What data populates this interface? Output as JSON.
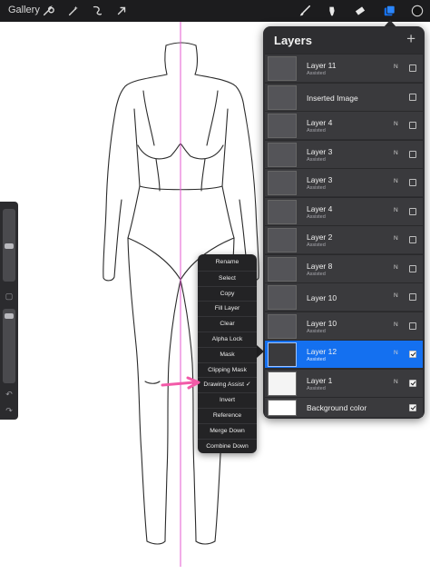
{
  "topbar": {
    "gallery_label": "Gallery",
    "left_tools": [
      "wrench-icon",
      "magic-wand-icon",
      "selection-icon",
      "transform-arrow-icon"
    ],
    "right_tools": [
      "brush-icon",
      "smudge-icon",
      "eraser-icon",
      "layers-icon",
      "color-icon"
    ]
  },
  "layers_panel": {
    "title": "Layers",
    "add_label": "+",
    "layers": [
      {
        "name": "Layer 11",
        "sub": "Assisted",
        "mode": "N",
        "visible": false,
        "selected": false
      },
      {
        "name": "Inserted Image",
        "sub": "",
        "mode": "",
        "visible": false,
        "selected": false
      },
      {
        "name": "Layer 4",
        "sub": "Assisted",
        "mode": "N",
        "visible": false,
        "selected": false
      },
      {
        "name": "Layer 3",
        "sub": "Assisted",
        "mode": "N",
        "visible": false,
        "selected": false
      },
      {
        "name": "Layer 3",
        "sub": "Assisted",
        "mode": "N",
        "visible": false,
        "selected": false
      },
      {
        "name": "Layer 4",
        "sub": "Assisted",
        "mode": "N",
        "visible": false,
        "selected": false
      },
      {
        "name": "Layer 2",
        "sub": "Assisted",
        "mode": "N",
        "visible": false,
        "selected": false
      },
      {
        "name": "Layer 8",
        "sub": "Assisted",
        "mode": "N",
        "visible": false,
        "selected": false
      },
      {
        "name": "Layer 10",
        "sub": "",
        "mode": "N",
        "visible": false,
        "selected": false
      },
      {
        "name": "Layer 10",
        "sub": "Assisted",
        "mode": "N",
        "visible": false,
        "selected": false
      },
      {
        "name": "Layer 12",
        "sub": "Assisted",
        "mode": "N",
        "visible": true,
        "selected": true
      },
      {
        "name": "Layer 1",
        "sub": "Assisted",
        "mode": "N",
        "visible": true,
        "selected": false
      },
      {
        "name": "Background color",
        "sub": "",
        "mode": "",
        "visible": true,
        "selected": false
      }
    ]
  },
  "context_menu": {
    "items": [
      "Rename",
      "Select",
      "Copy",
      "Fill Layer",
      "Clear",
      "Alpha Lock",
      "Mask",
      "Clipping Mask",
      "Drawing Assist ✓",
      "Invert",
      "Reference",
      "Merge Down",
      "Combine Down"
    ]
  },
  "colors": {
    "accent": "#1470f0",
    "annotation": "#f25aa8",
    "symmetry_guide": "#e45ad0",
    "active_color": "#141414"
  }
}
